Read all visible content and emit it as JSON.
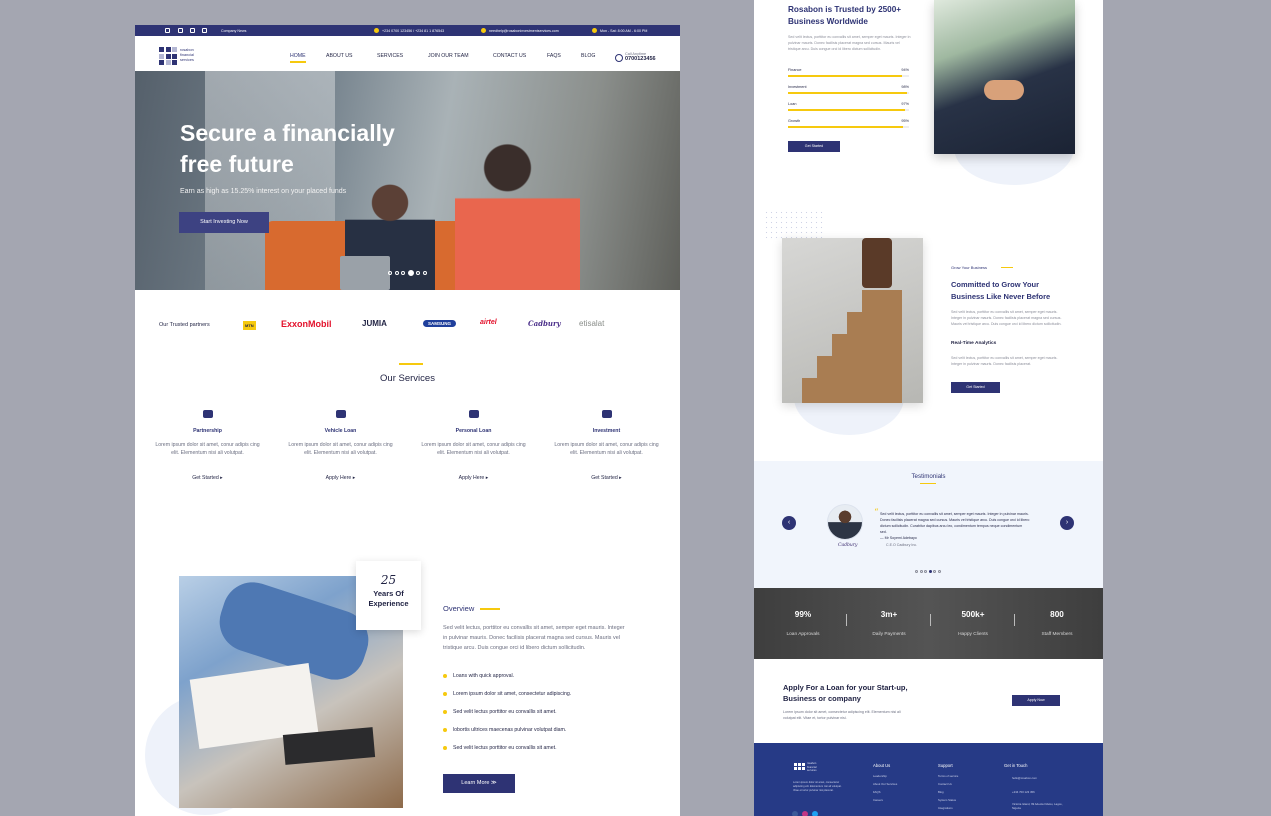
{
  "topbar": {
    "news": "Company News",
    "phones": "+234 0700 123456  /  +234 81 1 876543",
    "email": "needhelp@rosaboninvestmentservices.com",
    "hours": "Mon - Sat: 8:00 AM - 6:00 PM"
  },
  "brand": {
    "line1": "rosabon",
    "line2": "financial",
    "line3": "services"
  },
  "nav": {
    "items": [
      "HOME",
      "ABOUT US",
      "SERVICES",
      "JOIN OUR TEAM",
      "CONTACT US",
      "FAQS",
      "BLOG"
    ],
    "call_label": "Call Anytime",
    "call_number": "0700123456"
  },
  "hero": {
    "title": "Secure a financially free future",
    "subtitle": "Earn as high as 15.25% interest on your placed funds",
    "cta": "Start Investing Now"
  },
  "partners": {
    "label": "Our Trusted partners",
    "names": [
      "MTN",
      "ExxonMobil",
      "JUMIA",
      "SAMSUNG",
      "airtel",
      "Cadbury",
      "etisalat"
    ]
  },
  "services": {
    "title": "Our Services",
    "items": [
      {
        "title": "Partnership",
        "text": "Lorem ipsum dolor sit amet, conur adipis cing elit. Elementum nisi ali volutpat.",
        "link": "Get Started ▸"
      },
      {
        "title": "Vehicle Loan",
        "text": "Lorem ipsum dolor sit amet, conur adipis cing elit. Elementum nisi ali volutpat.",
        "link": "Apply Here ▸"
      },
      {
        "title": "Personal Loan",
        "text": "Lorem ipsum dolor sit amet, conur adipis cing elit. Elementum nisi ali volutpat.",
        "link": "Apply Here ▸"
      },
      {
        "title": "Investment",
        "text": "Lorem ipsum dolor sit amet, conur adipis cing elit. Elementum nisi ali volutpat.",
        "link": "Get Started ▸"
      }
    ]
  },
  "experience": {
    "number": "25",
    "label": "Years Of Experience"
  },
  "overview": {
    "title": "Overview",
    "text": "Sed velit lectus, porttitor eu convallis sit amet, semper eget mauris. Integer in pulvinar mauris. Donec facilisis placerat magna sed cursus. Mauris vel tristique arcu. Duis congue orci id libero dictum sollicitudin.",
    "bullets": [
      "Loans with quick approval.",
      "Lorem ipsum dolor sit amet, consectetur adipiscing.",
      "Sed velit lectus porttitor eu convallis sit amet.",
      "lobortis ultrices maecenas pulvinar volutpat diam.",
      "Sed velit lectus porttitor eu convallis sit amet."
    ],
    "cta": "Learn More  ≫"
  },
  "trust": {
    "title": "Rosabon is Trusted by 2500+ Business Worldwide",
    "text": "Sed velit lectus, porttitor eu convallis sit amet, semper eget mauris. Integer in pulvinar mauris. Donec facilisis placerat magna sed cursus. Mauris vel tristique arcu. Duis congue orci id libero dictum sollicitudin.",
    "bars": [
      {
        "label": "Finance",
        "value": 94,
        "text": "94%"
      },
      {
        "label": "Investment",
        "value": 98,
        "text": "98%"
      },
      {
        "label": "Loan",
        "value": 97,
        "text": "97%"
      },
      {
        "label": "Growth",
        "value": 95,
        "text": "95%"
      }
    ],
    "cta": "Get Started"
  },
  "grow": {
    "tag": "Grow Your Business",
    "title": "Committed to Grow Your Business Like Never Before",
    "text": "Sed velit lectus, porttitor eu convallis sit amet, semper eget mauris. Integer in pulvinar mauris. Donec facilisis placerat magna sed cursus. Mauris vel tristique arcu. Duis congue orci id libero dictum sollicitudin.",
    "subtitle": "Real-Time Analytics",
    "subtext": "Sed velit lectus, porttitor eu convallis sit amet, semper eget mauris. Integer in pulvinar mauris. Donec facilisis placerat.",
    "cta": "Get Started"
  },
  "testimonials": {
    "title": "Testimonials",
    "quote": "Sed velit lectus, porttitor eu convallis sit amet, semper eget mauris. Integer in pulvinar mauris. Donec facilisis placerat magna sed cursus. Mauris vel tristique arcu. Duis congue orci id libero dictum sollicitudin. Curabitur dapibus arcu leo, condimentum tempus neque condimentum sed.",
    "author": "—  Mr Soyemi Adebayo",
    "role": "C.E.O Cadbury Inc.",
    "company": "Cadbury",
    "prev": "‹",
    "next": "›"
  },
  "stats": [
    {
      "value": "99%",
      "label": "Loan Approvals"
    },
    {
      "value": "3m+",
      "label": "Daily Payments"
    },
    {
      "value": "500k+",
      "label": "Happy Clients"
    },
    {
      "value": "800",
      "label": "Staff Members"
    }
  ],
  "apply": {
    "title": "Apply For a Loan for your Start-up, Business or company",
    "text": "Lorem ipsum dolor sit amet, consectetur adipiscing elit. Elementum nisi ali volutpat elit. Vitae et, tortor pulvinar nisi.",
    "cta": "Apply Now"
  },
  "footer": {
    "desc": "Lorem ipsum dolor sit amet, consectetur adipiscing elit. Elementum nisi ali volutpat. Vitae et tortor pulvinar nisi placerat.",
    "about_head": "About Us",
    "about_links": [
      "Leadership",
      "About Our Services",
      "FAQS",
      "Careers"
    ],
    "support_head": "Support",
    "support_links": [
      "Terms of service",
      "Contact Us",
      "Blog",
      "System Status",
      "Integrations"
    ],
    "contact_head": "Get in Touch",
    "contact_items": [
      "hello@rosabon.com",
      "+234 700 123 456",
      "Victoria Island, 99 Adeola Odeku, Lagos, Nigeria"
    ]
  },
  "colors": {
    "primary": "#2e3374",
    "accent": "#f6c90e",
    "footer": "#263a86"
  }
}
